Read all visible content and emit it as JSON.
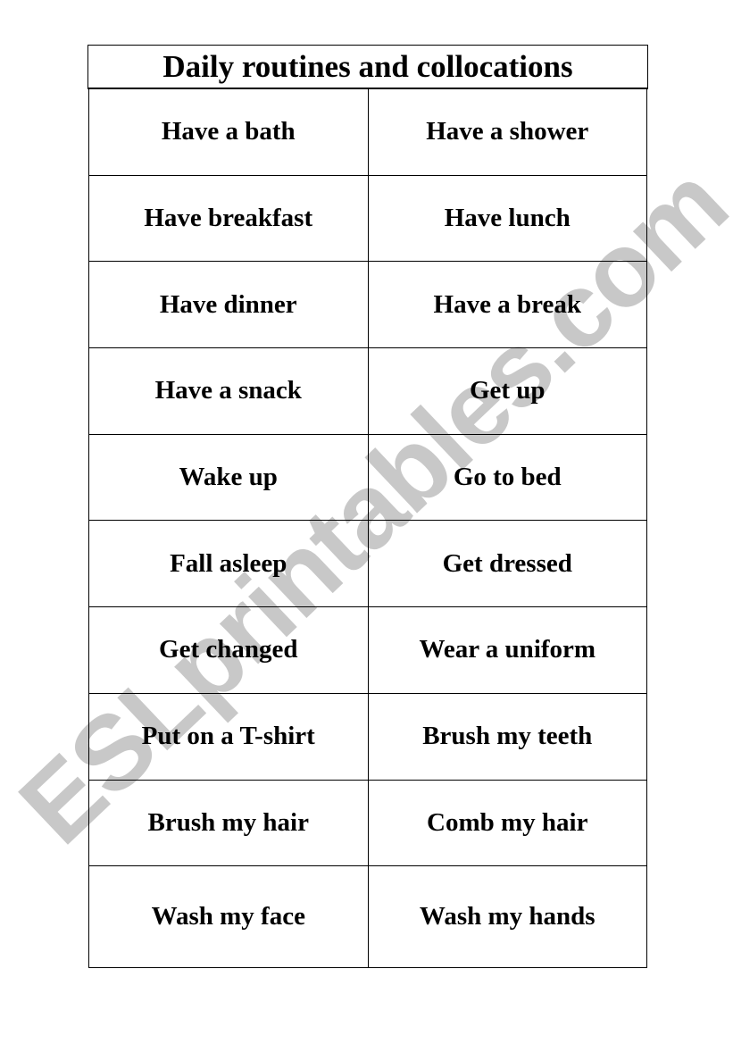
{
  "title": "Daily routines and collocations",
  "watermark": "ESLprintables.com",
  "rows": [
    [
      "Have a bath",
      "Have a shower"
    ],
    [
      "Have breakfast",
      "Have lunch"
    ],
    [
      "Have dinner",
      "Have a break"
    ],
    [
      "Have a snack",
      "Get up"
    ],
    [
      "Wake up",
      "Go to bed"
    ],
    [
      "Fall asleep",
      "Get dressed"
    ],
    [
      "Get changed",
      "Wear a uniform"
    ],
    [
      "Put on a T-shirt",
      "Brush my teeth"
    ],
    [
      "Brush my hair",
      "Comb my hair"
    ],
    [
      "Wash my face",
      "Wash my hands"
    ]
  ]
}
